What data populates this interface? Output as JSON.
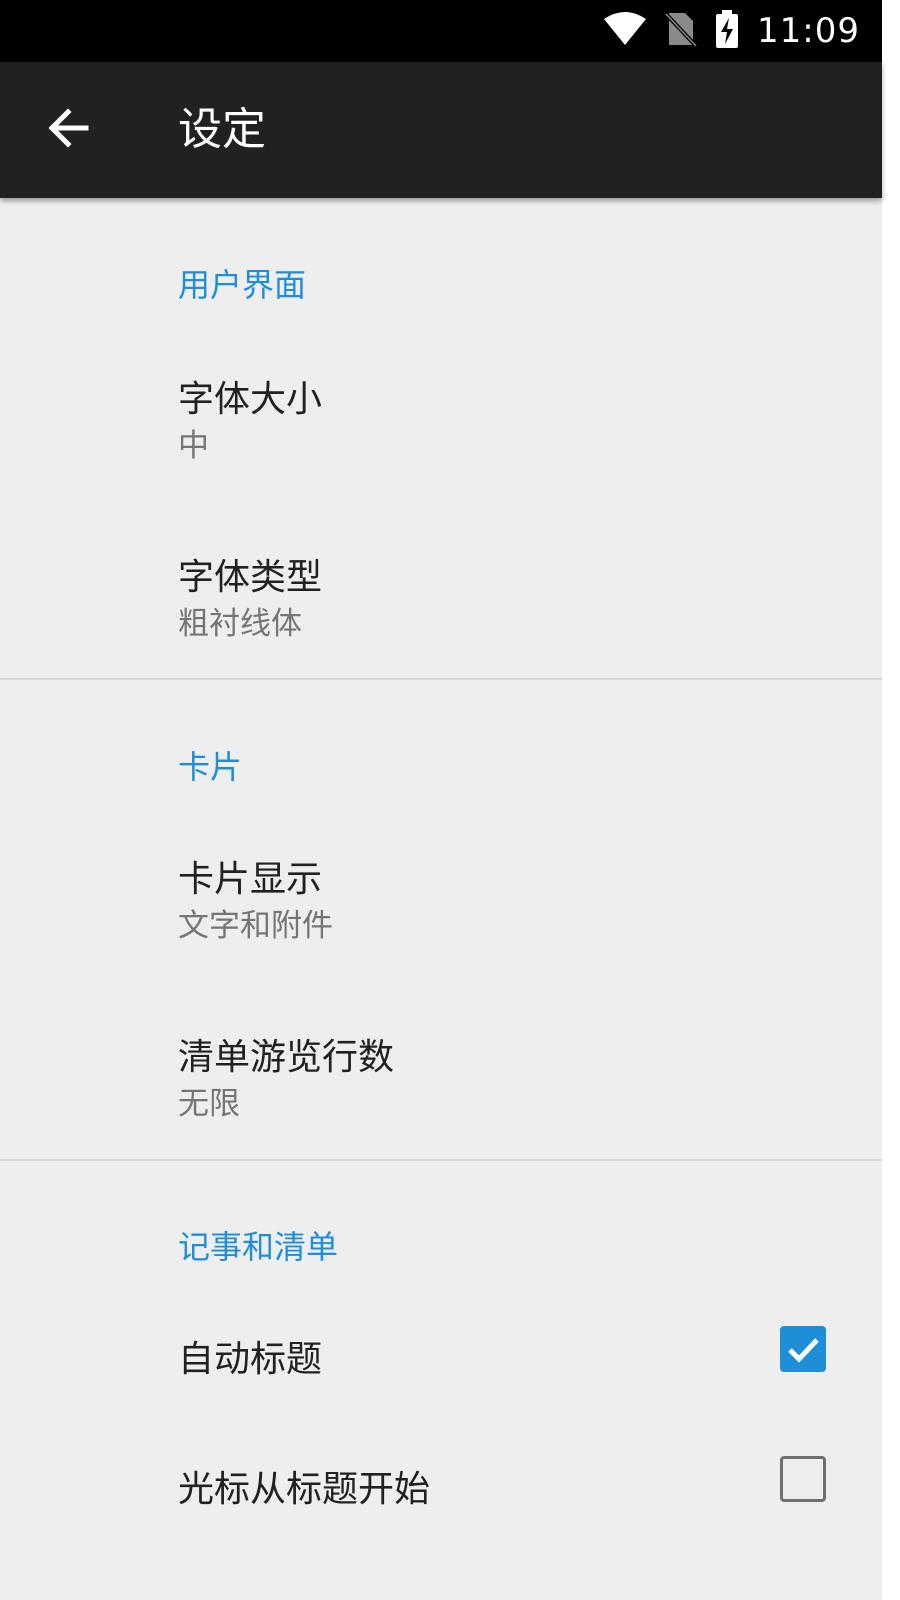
{
  "status_bar": {
    "time": "11:09"
  },
  "app_bar": {
    "title": "设定"
  },
  "sections": [
    {
      "header": "用户界面",
      "items": [
        {
          "title": "字体大小",
          "summary": "中"
        },
        {
          "title": "字体类型",
          "summary": "粗衬线体"
        }
      ]
    },
    {
      "header": "卡片",
      "items": [
        {
          "title": "卡片显示",
          "summary": "文字和附件"
        },
        {
          "title": "清单游览行数",
          "summary": "无限"
        }
      ]
    },
    {
      "header": "记事和清单",
      "items": [
        {
          "title": "自动标题",
          "checked": true
        },
        {
          "title": "光标从标题开始",
          "checked": false
        }
      ]
    }
  ],
  "colors": {
    "accent": "#1e8ed8",
    "app_bar": "#212121",
    "background": "#eeeeef"
  }
}
